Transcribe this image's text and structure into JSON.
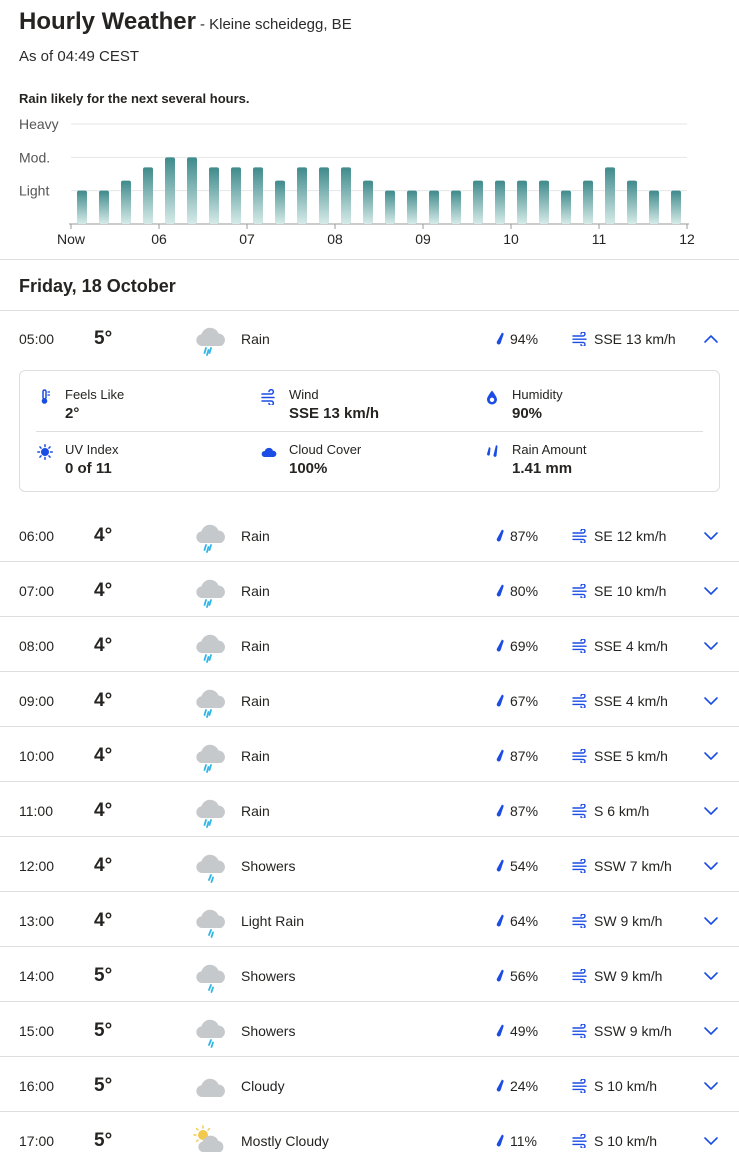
{
  "header": {
    "title": "Hourly Weather",
    "location": "- Kleine scheidegg, BE",
    "as_of": "As of 04:49 CEST",
    "rain_summary": "Rain likely for the next several hours."
  },
  "chart_data": {
    "type": "bar",
    "y_levels": [
      "Heavy",
      "Mod.",
      "Light"
    ],
    "x_tick_labels": [
      "Now",
      "06",
      "07",
      "08",
      "09",
      "10",
      "11",
      "12"
    ],
    "values": [
      1,
      1,
      1.3,
      1.7,
      2,
      2,
      1.7,
      1.7,
      1.7,
      1.3,
      1.7,
      1.7,
      1.7,
      1.3,
      1,
      1,
      1,
      1,
      1.3,
      1.3,
      1.3,
      1.3,
      1,
      1.3,
      1.7,
      1.3,
      1,
      1
    ],
    "ylim": [
      0,
      3
    ],
    "grid": true,
    "bar_color_top": "#3f8a8c",
    "bar_color_bottom": "#d6ebe8"
  },
  "day_heading": "Friday, 18 October",
  "expanded_details": {
    "feels_like": {
      "label": "Feels Like",
      "value": "2°"
    },
    "wind": {
      "label": "Wind",
      "value": "SSE 13 km/h"
    },
    "humidity": {
      "label": "Humidity",
      "value": "90%"
    },
    "uv_index": {
      "label": "UV Index",
      "value": "0 of 11"
    },
    "cloud_cover": {
      "label": "Cloud Cover",
      "value": "100%"
    },
    "rain_amount": {
      "label": "Rain Amount",
      "value": "1.41 mm"
    }
  },
  "hours": [
    {
      "time": "05:00",
      "temp": "5°",
      "condition": "Rain",
      "icon": "rain-icon",
      "precip": "94%",
      "wind": "SSE 13 km/h",
      "expanded": true
    },
    {
      "time": "06:00",
      "temp": "4°",
      "condition": "Rain",
      "icon": "rain-icon",
      "precip": "87%",
      "wind": "SE 12 km/h"
    },
    {
      "time": "07:00",
      "temp": "4°",
      "condition": "Rain",
      "icon": "rain-icon",
      "precip": "80%",
      "wind": "SE 10 km/h"
    },
    {
      "time": "08:00",
      "temp": "4°",
      "condition": "Rain",
      "icon": "rain-icon",
      "precip": "69%",
      "wind": "SSE 4 km/h"
    },
    {
      "time": "09:00",
      "temp": "4°",
      "condition": "Rain",
      "icon": "rain-icon",
      "precip": "67%",
      "wind": "SSE 4 km/h"
    },
    {
      "time": "10:00",
      "temp": "4°",
      "condition": "Rain",
      "icon": "rain-icon",
      "precip": "87%",
      "wind": "SSE 5 km/h"
    },
    {
      "time": "11:00",
      "temp": "4°",
      "condition": "Rain",
      "icon": "rain-icon",
      "precip": "87%",
      "wind": "S 6 km/h"
    },
    {
      "time": "12:00",
      "temp": "4°",
      "condition": "Showers",
      "icon": "showers-icon",
      "precip": "54%",
      "wind": "SSW 7 km/h"
    },
    {
      "time": "13:00",
      "temp": "4°",
      "condition": "Light Rain",
      "icon": "showers-icon",
      "precip": "64%",
      "wind": "SW 9 km/h"
    },
    {
      "time": "14:00",
      "temp": "5°",
      "condition": "Showers",
      "icon": "showers-icon",
      "precip": "56%",
      "wind": "SW 9 km/h"
    },
    {
      "time": "15:00",
      "temp": "5°",
      "condition": "Showers",
      "icon": "showers-icon",
      "precip": "49%",
      "wind": "SSW 9 km/h"
    },
    {
      "time": "16:00",
      "temp": "5°",
      "condition": "Cloudy",
      "icon": "cloudy-icon",
      "precip": "24%",
      "wind": "S 10 km/h"
    },
    {
      "time": "17:00",
      "temp": "5°",
      "condition": "Mostly Cloudy",
      "icon": "mostly-cloudy-icon",
      "precip": "11%",
      "wind": "S 10 km/h"
    }
  ],
  "colors": {
    "accent_blue": "#1b4de4",
    "cloud_gray": "#c6c9cc",
    "rain_drop": "#33b5e5",
    "sun_yellow": "#f2c94c"
  }
}
